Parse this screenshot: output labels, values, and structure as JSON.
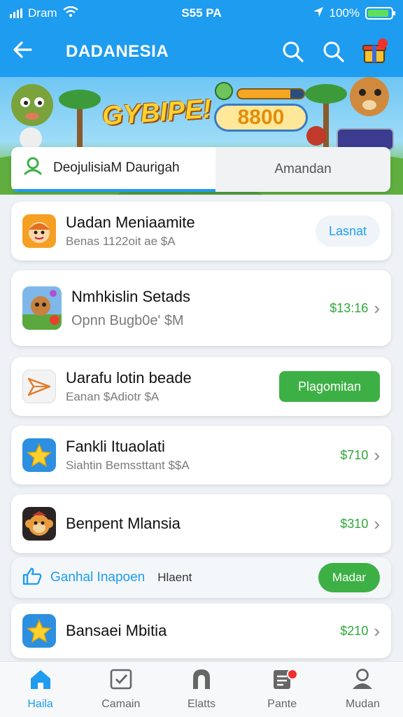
{
  "status_bar": {
    "carrier": "Dram",
    "time": "S55 PA",
    "battery": "100%",
    "battery_level": 0.9,
    "icons": [
      "signal-icon",
      "wifi-icon",
      "location-icon",
      "battery-icon"
    ]
  },
  "app_bar": {
    "title": "DADANESIA",
    "icons": [
      "back-arrow-icon",
      "search-icon",
      "search-icon",
      "gift-box-icon"
    ]
  },
  "banner": {
    "title": "GYBIPE!",
    "score": "8800",
    "progress": 0.8
  },
  "tabs": {
    "active_label": "DeojulisiaM Daurigah",
    "inactive_label": "Amandan"
  },
  "items": [
    {
      "name": "Uadan Meniaamite",
      "subtitle": "Benas 1122oit ae $A",
      "action": "Lasnat",
      "icon": "cartoon-face-icon"
    },
    {
      "name": "Nmhkislin Setads",
      "subtitle": "Opnn Bugb0e' $M",
      "price": "$13:16",
      "icon": "game-character-icon"
    },
    {
      "name": "Uarafu lotin beade",
      "subtitle": "Eanan $Adiotr $A",
      "action": "Plagomitan",
      "icon": "paper-plane-icon"
    },
    {
      "name": "Fankli Ituaolati",
      "subtitle": "Siahtin Bemssttant $$A",
      "price": "$710",
      "icon": "star-icon"
    },
    {
      "name": "Benpent Mlansia",
      "price": "$310",
      "icon": "monkey-face-icon"
    },
    {
      "name": "Bansaei Mbitia",
      "price": "$210",
      "icon": "star-icon"
    }
  ],
  "promo": {
    "label": "Ganhal Inapoen",
    "extra": "Hlaent",
    "button": "Madar",
    "icon": "thumbs-up-icon"
  },
  "nav": [
    {
      "label": "Haila",
      "icon": "home-icon",
      "active": true
    },
    {
      "label": "Camain",
      "icon": "calendar-check-icon"
    },
    {
      "label": "Elatts",
      "icon": "arch-icon"
    },
    {
      "label": "Pante",
      "icon": "document-icon",
      "badge": true
    },
    {
      "label": "Mudan",
      "icon": "person-icon"
    }
  ],
  "colors": {
    "primary": "#1e9cef",
    "green": "#3db045",
    "price": "#2ea83a",
    "badge": "#f0302c"
  }
}
